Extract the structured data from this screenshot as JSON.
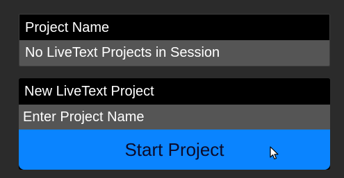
{
  "session_panel": {
    "label": "Project Name",
    "value": "No LiveText Projects in Session"
  },
  "new_project_panel": {
    "label": "New LiveText Project",
    "input_placeholder": "Enter Project Name",
    "input_value": "",
    "start_button_label": "Start Project"
  },
  "colors": {
    "background": "#2b2b2b",
    "panel": "#000000",
    "field": "#555555",
    "button": "#0a84ff"
  },
  "icons": {
    "cursor": "mouse-pointer-icon"
  }
}
